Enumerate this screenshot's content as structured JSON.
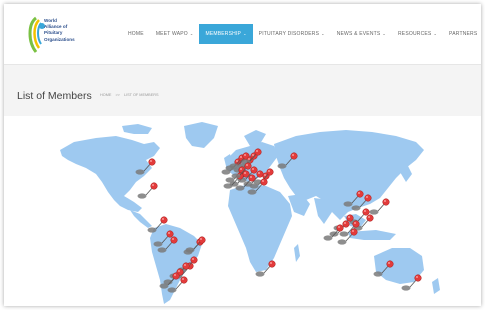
{
  "logo": {
    "lines": [
      "World",
      "Alliance of",
      "Pituitary",
      "Organizations"
    ]
  },
  "nav": {
    "items": [
      {
        "label": "HOME",
        "has_dropdown": false,
        "active": false
      },
      {
        "label": "MEET WAPO",
        "has_dropdown": true,
        "active": false
      },
      {
        "label": "MEMBERSHIP",
        "has_dropdown": true,
        "active": true
      },
      {
        "label": "PITUITARY DISORDERS",
        "has_dropdown": true,
        "active": false
      },
      {
        "label": "NEWS & EVENTS",
        "has_dropdown": true,
        "active": false
      },
      {
        "label": "RESOURCES",
        "has_dropdown": true,
        "active": false
      },
      {
        "label": "PARTNERS",
        "has_dropdown": false,
        "active": false
      }
    ],
    "dropdown_icon": "chevron-down-icon"
  },
  "page": {
    "title": "List of Members",
    "breadcrumb": [
      "HOME",
      ">>",
      "LIST OF MEMBERS"
    ]
  },
  "colors": {
    "accent": "#3aa7d9",
    "map_land": "#9ec9f0",
    "pin": "#e23b3b",
    "pin_shadow": "#7a7a7a",
    "logo_text": "#2c4f8c"
  },
  "map": {
    "marker_icon": "map-pin-icon",
    "marker_count": 52
  }
}
